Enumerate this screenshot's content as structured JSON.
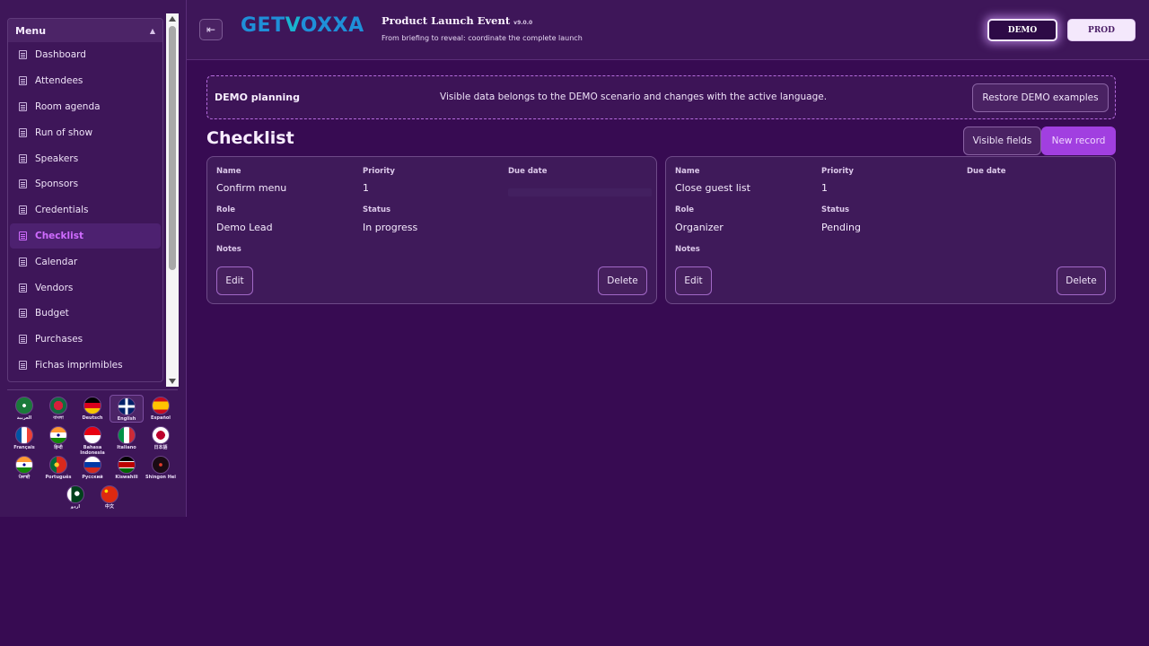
{
  "sidebar": {
    "menu_title": "Menu",
    "items": [
      {
        "label": "Dashboard"
      },
      {
        "label": "Attendees"
      },
      {
        "label": "Room agenda"
      },
      {
        "label": "Run of show"
      },
      {
        "label": "Speakers"
      },
      {
        "label": "Sponsors"
      },
      {
        "label": "Credentials"
      },
      {
        "label": "Checklist",
        "active": true
      },
      {
        "label": "Calendar"
      },
      {
        "label": "Vendors"
      },
      {
        "label": "Budget"
      },
      {
        "label": "Purchases"
      },
      {
        "label": "Fichas imprimibles"
      }
    ],
    "languages": [
      {
        "name": "العربية"
      },
      {
        "name": "বাংলা"
      },
      {
        "name": "Deutsch"
      },
      {
        "name": "English",
        "selected": true
      },
      {
        "name": "Español"
      },
      {
        "name": "Français"
      },
      {
        "name": "हिन्दी"
      },
      {
        "name": "Bahasa Indonesia"
      },
      {
        "name": "Italiano"
      },
      {
        "name": "日本語"
      },
      {
        "name": "ਪੰਜਾਬੀ"
      },
      {
        "name": "Português"
      },
      {
        "name": "Русский"
      },
      {
        "name": "Kiswahili"
      },
      {
        "name": "Shingon Hei"
      },
      {
        "name": "اردو"
      },
      {
        "name": "中文"
      }
    ]
  },
  "header": {
    "logo_text_a": "GET",
    "logo_text_b": "V",
    "logo_text_c": "OXXA",
    "title": "Product Launch Event",
    "version": "v9.0.0",
    "subtitle": "From briefing to reveal: coordinate the complete launch",
    "env_demo": "DEMO",
    "env_prod": "PROD"
  },
  "banner": {
    "title": "DEMO planning",
    "text": "Visible data belongs to the DEMO scenario and changes with the active language.",
    "restore_label": "Restore DEMO examples"
  },
  "main": {
    "page_title": "Checklist",
    "visible_fields_label": "Visible fields",
    "new_record_label": "New record",
    "field_labels": {
      "name": "Name",
      "priority": "Priority",
      "due_date": "Due date",
      "role": "Role",
      "status": "Status",
      "notes": "Notes"
    },
    "edit_label": "Edit",
    "delete_label": "Delete",
    "records": [
      {
        "name": "Confirm menu",
        "priority": "1",
        "due_date": "",
        "role": "Demo Lead",
        "status": "In progress",
        "notes": ""
      },
      {
        "name": "Close guest list",
        "priority": "1",
        "due_date": "",
        "role": "Organizer",
        "status": "Pending",
        "notes": ""
      }
    ]
  },
  "colors": {
    "background": "#370b52",
    "accent": "#a13fe0",
    "active_menu": "#d06cff"
  }
}
